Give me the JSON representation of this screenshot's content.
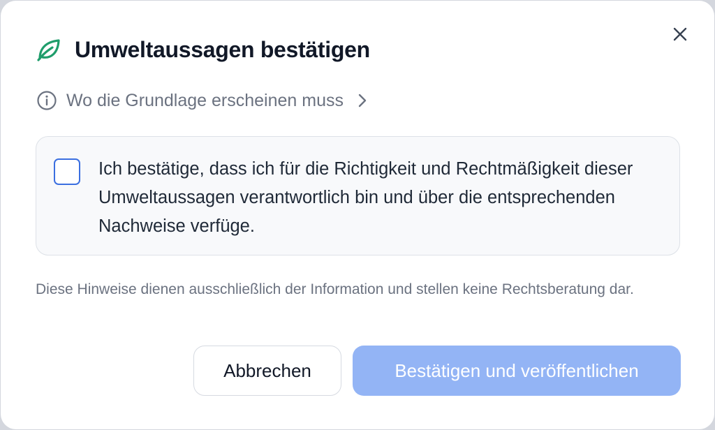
{
  "dialog": {
    "title": "Umweltaussagen bestätigen",
    "icons": {
      "title_icon": "leaf-icon",
      "close_icon": "close-icon",
      "info_icon": "info-icon",
      "chevron_icon": "chevron-right-icon"
    },
    "info_link": {
      "label": "Wo die Grundlage erscheinen muss"
    },
    "confirmation": {
      "checked": false,
      "text": "Ich bestätige, dass ich für die Richtigkeit und Rechtmäßigkeit dieser Umweltaussagen verantwortlich bin und über die entsprechenden Nachweise verfüge."
    },
    "disclaimer": "Diese Hinweise dienen ausschließlich der Information und stellen keine Rechtsberatung dar.",
    "buttons": {
      "cancel_label": "Abbrechen",
      "confirm_label": "Bestätigen und veröffentlichen",
      "confirm_disabled": true
    }
  },
  "colors": {
    "leaf_green": "#1f9d6b",
    "checkbox_border": "#3b6fe0",
    "confirm_button_disabled": "#93b4f5",
    "title_text": "#111827",
    "muted_text": "#6b7280"
  }
}
